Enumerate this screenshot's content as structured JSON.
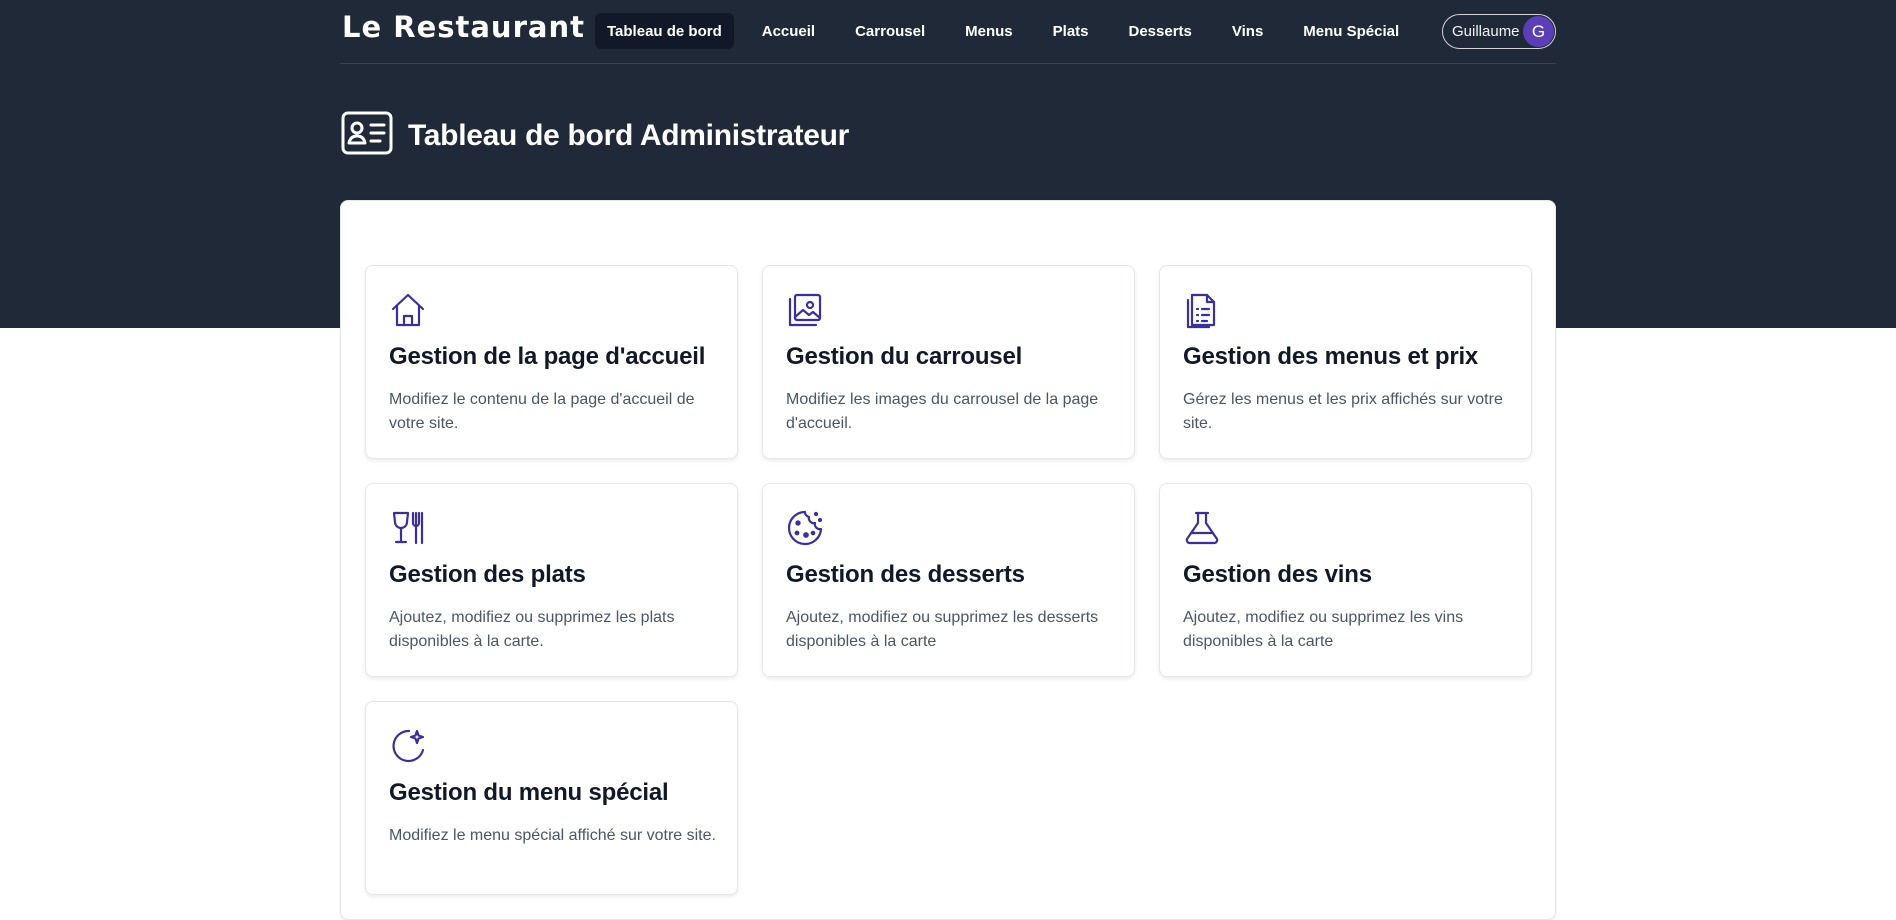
{
  "header": {
    "brand": "Le Restaurant",
    "nav": [
      "Tableau de bord",
      "Accueil",
      "Carrousel",
      "Menus",
      "Plats",
      "Desserts",
      "Vins",
      "Menu Spécial"
    ],
    "active_nav": "Tableau de bord",
    "user": {
      "name": "Guillaume",
      "initial": "G"
    }
  },
  "page": {
    "title": "Tableau de bord Administrateur",
    "icon": "id-card-icon"
  },
  "cards": [
    {
      "icon": "house-icon",
      "title": "Gestion de la page d'accueil",
      "description": "Modifiez le contenu de la page d'accueil de votre site."
    },
    {
      "icon": "image-gallery-icon",
      "title": "Gestion du carrousel",
      "description": "Modifiez les images du carrousel de la page d'accueil."
    },
    {
      "icon": "document-list-icon",
      "title": "Gestion des menus et prix",
      "description": "Gérez les menus et les prix affichés sur votre site."
    },
    {
      "icon": "wine-glass-fork-icon",
      "title": "Gestion des plats",
      "description": "Ajoutez, modifiez ou supprimez les plats disponibles à la carte."
    },
    {
      "icon": "cookie-icon",
      "title": "Gestion des desserts",
      "description": "Ajoutez, modifiez ou supprimez les desserts disponibles à la carte"
    },
    {
      "icon": "flask-icon",
      "title": "Gestion des vins",
      "description": "Ajoutez, modifiez ou supprimez les vins disponibles à la carte"
    },
    {
      "icon": "moon-sparkle-icon",
      "title": "Gestion du menu spécial",
      "description": "Modifiez le menu spécial affiché sur votre site."
    }
  ],
  "colors": {
    "header_bg": "#1f2937",
    "accent": "#3b2fa0",
    "avatar": "#5b3fb8"
  }
}
